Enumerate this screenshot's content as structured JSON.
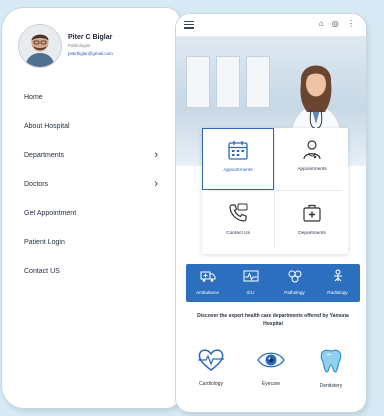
{
  "drawer": {
    "user": {
      "name": "Piter C Biglar",
      "role": "Pathologist",
      "email": "piterbiglar@gmail.com"
    },
    "menu": [
      {
        "label": "Home",
        "has_submenu": false
      },
      {
        "label": "About Hospital",
        "has_submenu": false
      },
      {
        "label": "Departments",
        "has_submenu": true
      },
      {
        "label": "Doctors",
        "has_submenu": true
      },
      {
        "label": "Get Appointment",
        "has_submenu": false
      },
      {
        "label": "Patient Login",
        "has_submenu": false
      },
      {
        "label": "Contact US",
        "has_submenu": false
      }
    ],
    "chevron": "›"
  },
  "app": {
    "topbar_icons": "⌂ ◎ ⋮",
    "grid": [
      {
        "label": "Appointments",
        "icon": "calendar-icon",
        "selected": true
      },
      {
        "label": "Appointments",
        "icon": "doctor-icon",
        "selected": false
      },
      {
        "label": "Contact Us",
        "icon": "phone-icon",
        "selected": false
      },
      {
        "label": "Departments",
        "icon": "first-aid-icon",
        "selected": false
      }
    ],
    "strip": [
      {
        "label": "Ambulance",
        "icon": "ambulance-icon"
      },
      {
        "label": "ICU",
        "icon": "icu-icon"
      },
      {
        "label": "Pathology",
        "icon": "pathology-icon"
      },
      {
        "label": "Radiology",
        "icon": "radiology-icon"
      }
    ],
    "discover_text": "Discover the expert health care departments offered by Yamuna Hospital",
    "specialties": [
      {
        "label": "Cardiology",
        "icon": "heart-icon"
      },
      {
        "label": "Eyecare",
        "icon": "eye-icon"
      },
      {
        "label": "Dentistery",
        "icon": "tooth-icon"
      }
    ],
    "colors": {
      "accent": "#2d6fbf",
      "background": "#d7e9f5"
    }
  }
}
